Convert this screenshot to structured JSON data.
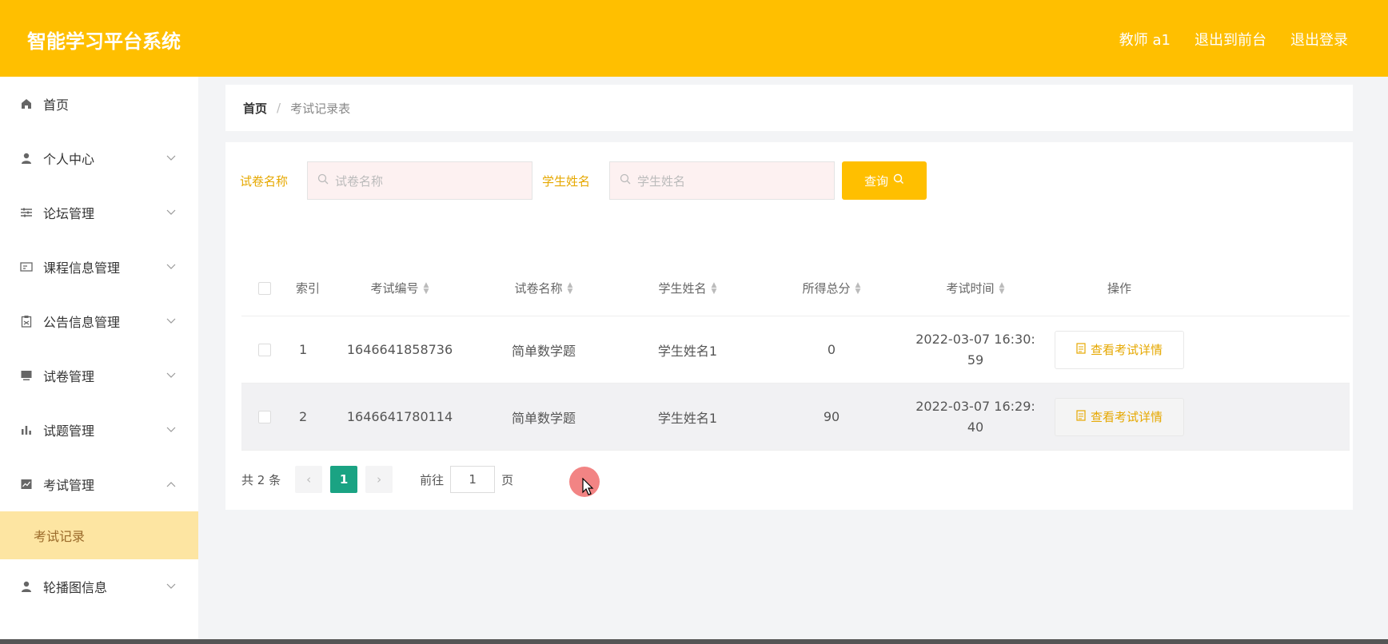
{
  "header": {
    "title": "智能学习平台系统",
    "user": "教师 a1",
    "exit_front": "退出到前台",
    "logout": "退出登录"
  },
  "sidebar": {
    "items": [
      {
        "label": "首页",
        "icon": "home-icon"
      },
      {
        "label": "个人中心",
        "icon": "user-icon"
      },
      {
        "label": "论坛管理",
        "icon": "sliders-icon"
      },
      {
        "label": "课程信息管理",
        "icon": "card-icon"
      },
      {
        "label": "公告信息管理",
        "icon": "clipboard-icon"
      },
      {
        "label": "试卷管理",
        "icon": "monitor-icon"
      },
      {
        "label": "试题管理",
        "icon": "bar-chart-icon"
      },
      {
        "label": "考试管理",
        "icon": "line-chart-icon"
      },
      {
        "label": "轮播图信息",
        "icon": "user-icon"
      }
    ],
    "sub_item": "考试记录"
  },
  "breadcrumb": {
    "home": "首页",
    "separator": "/",
    "current": "考试记录表"
  },
  "search": {
    "paper_label": "试卷名称",
    "paper_placeholder": "试卷名称",
    "student_label": "学生姓名",
    "student_placeholder": "学生姓名",
    "button": "查询"
  },
  "table": {
    "columns": [
      "索引",
      "考试编号",
      "试卷名称",
      "学生姓名",
      "所得总分",
      "考试时间",
      "操作"
    ],
    "rows": [
      {
        "index": "1",
        "exam_no": "1646641858736",
        "paper": "简单数学题",
        "student": "学生姓名1",
        "score": "0",
        "time_1": "2022-03-07 16:30:",
        "time_2": "59",
        "action": "查看考试详情"
      },
      {
        "index": "2",
        "exam_no": "1646641780114",
        "paper": "简单数学题",
        "student": "学生姓名1",
        "score": "90",
        "time_1": "2022-03-07 16:29:",
        "time_2": "40",
        "action": "查看考试详情"
      }
    ]
  },
  "pagination": {
    "total": "共 2 条",
    "prev": "‹",
    "current": "1",
    "next": "›",
    "goto_label": "前往",
    "goto_value": "1",
    "page_unit": "页"
  },
  "colors": {
    "accent": "#ffbf00",
    "active_page": "#1aa383",
    "label": "#e6a800"
  }
}
